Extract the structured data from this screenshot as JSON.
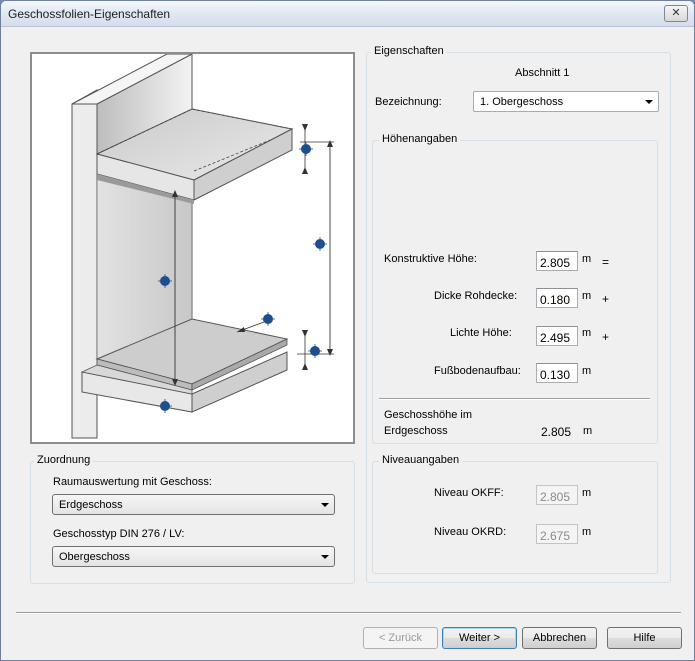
{
  "window": {
    "title": "Geschossfolien-Eigenschaften",
    "close_glyph": "✕"
  },
  "eigenschaften": {
    "group_label": "Eigenschaften",
    "section_title": "Abschnitt 1",
    "bezeichnung_label": "Bezeichnung:",
    "bezeichnung_value": "1. Obergeschoss"
  },
  "hoehenangaben": {
    "group_label": "Höhenangaben",
    "rows": [
      {
        "label": "Konstruktive Höhe:",
        "value": "2.805",
        "unit": "m",
        "op": "="
      },
      {
        "label": "Dicke Rohdecke:",
        "value": "0.180",
        "unit": "m",
        "op": "+"
      },
      {
        "label": "Lichte Höhe:",
        "value": "2.495",
        "unit": "m",
        "op": "+"
      },
      {
        "label": "Fußbodenaufbau:",
        "value": "0.130",
        "unit": "m",
        "op": ""
      }
    ],
    "geschosshoehe_label_line1": "Geschosshöhe im",
    "geschosshoehe_label_line2": "Erdgeschoss",
    "geschosshoehe_value": "2.805",
    "geschosshoehe_unit": "m"
  },
  "niveauangaben": {
    "group_label": "Niveauangaben",
    "rows": [
      {
        "label": "Niveau OKFF:",
        "value": "2.805",
        "unit": "m"
      },
      {
        "label": "Niveau OKRD:",
        "value": "2.675",
        "unit": "m"
      }
    ]
  },
  "zuordnung": {
    "group_label": "Zuordnung",
    "raumauswertung_label": "Raumauswertung mit Geschoss:",
    "raumauswertung_value": "Erdgeschoss",
    "geschosstyp_label": "Geschosstyp DIN 276 / LV:",
    "geschosstyp_value": "Obergeschoss"
  },
  "buttons": {
    "back": "< Zurück",
    "next": "Weiter >",
    "cancel": "Abbrechen",
    "help": "Hilfe"
  },
  "colors": {
    "marker": "#1f4e8c",
    "slab_top": "#d4d4d4",
    "slab_front": "#e6e6e6"
  }
}
